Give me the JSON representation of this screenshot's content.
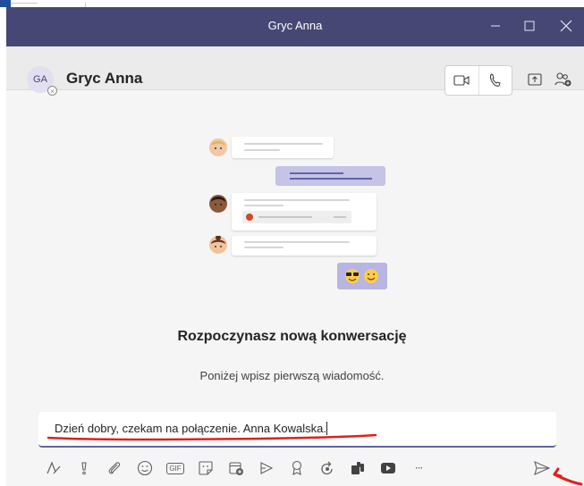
{
  "window": {
    "title": "Gryc Anna"
  },
  "header": {
    "avatar_initials": "GA",
    "contact_name": "Gryc Anna"
  },
  "empty_state": {
    "title": "Rozpoczynasz nową konwersację",
    "subtitle": "Poniżej wpisz pierwszą wiadomość."
  },
  "compose": {
    "value": "Dzień dobry, czekam na połączenie. Anna Kowalska."
  },
  "toolbar": {
    "gif_label": "GIF",
    "more_label": "···"
  },
  "colors": {
    "titlebar": "#464775",
    "accent": "#6264a7",
    "annotation_red": "#e0201b"
  }
}
